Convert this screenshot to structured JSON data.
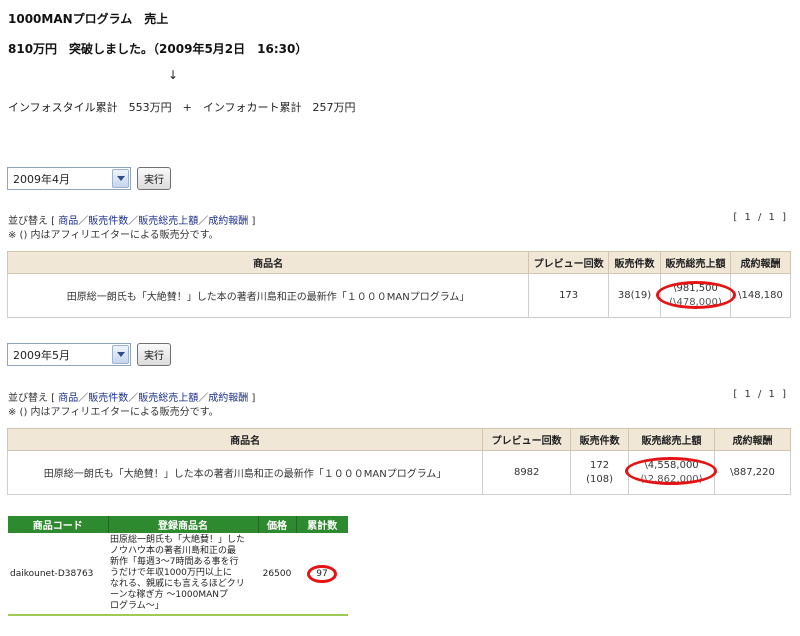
{
  "header": {
    "title": "1000MANプログラム　売上",
    "milestone": "810万円　突破しました。（2009年5月2日　16:30）",
    "arrow": "↓",
    "summary": "インフォスタイル累計　553万円　+　インフォカート累計　257万円"
  },
  "sections": [
    {
      "month": "2009年4月",
      "run_label": "実行",
      "sort_prefix": "並び替え [ ",
      "sort_links": [
        "商品",
        "販売件数",
        "販売総売上額",
        "成約報酬"
      ],
      "sort_sep": "／",
      "sort_suffix": " ]",
      "note": "※ () 内はアフィリエイターによる販売分です。",
      "pager": "[ 1 / 1 ]",
      "columns": [
        "商品名",
        "プレビュー回数",
        "販売件数",
        "販売総売上額",
        "成約報酬"
      ],
      "row": {
        "name": "田原総一朗氏も「大絶賛！」した本の著者川島和正の最新作「１０００MANプログラム」",
        "previews": "173",
        "sold": "38(19)",
        "sold_sub": "",
        "sales": "\\981,500",
        "sales_sub": "(\\478,000)",
        "reward": "\\148,180"
      }
    },
    {
      "month": "2009年5月",
      "run_label": "実行",
      "sort_prefix": "並び替え [ ",
      "sort_links": [
        "商品",
        "販売件数",
        "販売総売上額",
        "成約報酬"
      ],
      "sort_sep": "／",
      "sort_suffix": " ]",
      "note": "※ () 内はアフィリエイターによる販売分です。",
      "pager": "[ 1 / 1 ]",
      "columns": [
        "商品名",
        "プレビュー回数",
        "販売件数",
        "販売総売上額",
        "成約報酬"
      ],
      "row": {
        "name": "田原総一朗氏も「大絶賛！」した本の著者川島和正の最新作「１０００MANプログラム」",
        "previews": "8982",
        "sold": "172",
        "sold_sub": "(108)",
        "sales": "\\4,558,000",
        "sales_sub": "(\\2,862,000)",
        "reward": "\\887,220"
      }
    }
  ],
  "product_table": {
    "columns": [
      "商品コード",
      "登録商品名",
      "価格",
      "累計数"
    ],
    "row": {
      "code": "daikounet-D38763",
      "name": "田原総一朗氏も「大絶賛！」した\nノウハウ本の著者川島和正の最\n新作「毎週3〜7時間ある事を行\nうだけで年収1000万円以上に\nなれる、親戚にも言えるほどクリ\nーンな稼ぎ方 〜1000MANプ\nログラム〜」",
      "price": "26500",
      "count": "97"
    }
  },
  "colors": {
    "highlight_ring": "#e51414",
    "table_header_bg": "#f1e7d7",
    "product_header_bg": "#2e8a2e",
    "link": "#1c2f8a"
  }
}
